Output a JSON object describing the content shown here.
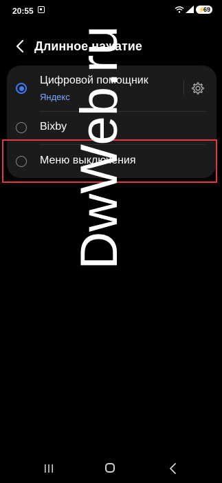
{
  "status_bar": {
    "time": "20:55",
    "battery_level": "69",
    "icons": [
      "screen-record-icon",
      "wifi-icon",
      "signal-icon",
      "battery-icon"
    ]
  },
  "header": {
    "title": "Длинное нажатие",
    "back_icon": "chevron-left-icon"
  },
  "options": [
    {
      "label": "Цифровой помощник",
      "sublabel": "Яндекс",
      "checked": true,
      "icon": "gear-icon"
    },
    {
      "label": "Bixby",
      "checked": false
    },
    {
      "label": "Меню выключения",
      "checked": false
    }
  ],
  "watermark": {
    "text": "DwWeb.ru"
  },
  "nav_bar": {
    "icons": [
      "recents-icon",
      "home-icon",
      "back-icon"
    ]
  },
  "colors": {
    "background": "#000000",
    "card": "#1b1b1b",
    "accent": "#3e7bf7",
    "sublabel": "#7fa6ff",
    "highlight": "#e23a45"
  }
}
